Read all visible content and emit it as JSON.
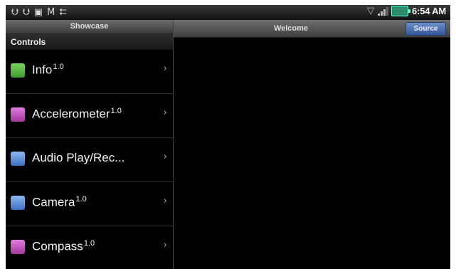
{
  "status_bar": {
    "notification_icons": [
      "usb-icon",
      "usb-debug-icon",
      "sd-card-icon",
      "gmail-icon",
      "usb-connected-icon"
    ],
    "time": "6:54 AM"
  },
  "left_pane": {
    "title": "Showcase",
    "section": "Controls",
    "items": [
      {
        "label": "Info",
        "version": "1.0",
        "icon": "info-icon",
        "icon_color": "#4cae3a"
      },
      {
        "label": "Accelerometer",
        "version": "1.0",
        "icon": "accelerometer-icon",
        "icon_color": "#b24fae"
      },
      {
        "label": "Audio Play/Rec...",
        "version": "",
        "icon": "audio-icon",
        "icon_color": "#4a7fcf"
      },
      {
        "label": "Camera",
        "version": "1.0",
        "icon": "camera-icon",
        "icon_color": "#4a7fcf"
      },
      {
        "label": "Compass",
        "version": "1.0",
        "icon": "compass-icon",
        "icon_color": "#b24fae"
      }
    ]
  },
  "right_pane": {
    "title": "Welcome",
    "source_button": "Source"
  }
}
